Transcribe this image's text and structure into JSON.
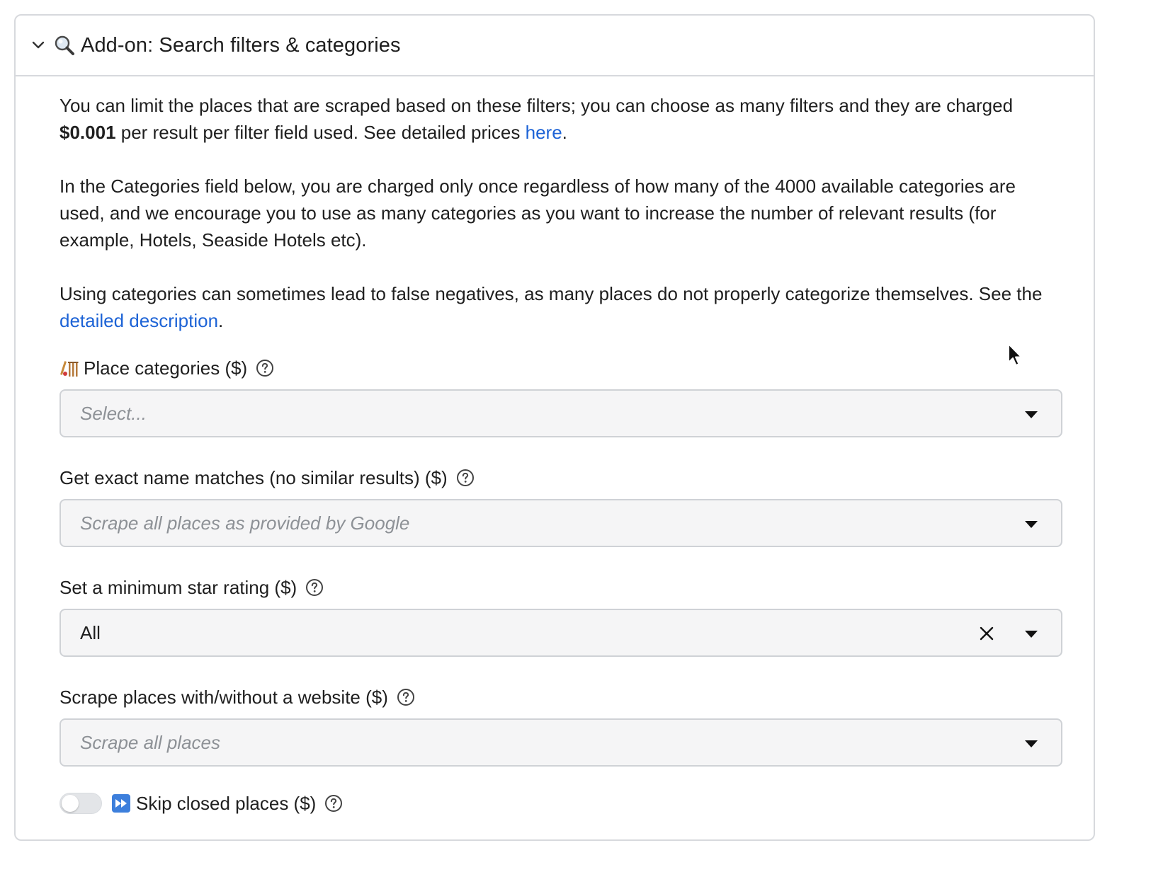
{
  "section": {
    "title": "Add-on: Search filters & categories",
    "expanded": true
  },
  "description": {
    "p1_before": "You can limit the places that are scraped based on these filters; you can choose as many filters and they are charged ",
    "p1_price": "$0.001",
    "p1_after": " per result per filter field used. See detailed prices ",
    "p1_link": "here",
    "p1_end": ".",
    "p2": "In the Categories field below, you are charged only once regardless of how many of the 4000 available categories are used, and we encourage you to use as many categories as you want to increase the number of relevant results (for example, Hotels, Seaside Hotels etc).",
    "p3_before": "Using categories can sometimes lead to false negatives, as many places do not properly categorize themselves. See the ",
    "p3_link": "detailed description",
    "p3_end": "."
  },
  "fields": {
    "categories": {
      "label": "Place categories ($)",
      "placeholder": "Select...",
      "icon": "cricket-icon"
    },
    "exact_match": {
      "label": "Get exact name matches (no similar results) ($)",
      "placeholder": "Scrape all places as provided by Google"
    },
    "star_rating": {
      "label": "Set a minimum star rating ($)",
      "value": "All"
    },
    "website": {
      "label": "Scrape places with/without a website ($)",
      "placeholder": "Scrape all places"
    },
    "skip_closed": {
      "label": "Skip closed places ($)",
      "enabled": false,
      "icon": "fast-forward-icon"
    }
  },
  "colors": {
    "link": "#1d63d6",
    "border": "#d7d9dd",
    "field_bg": "#f5f5f6"
  }
}
